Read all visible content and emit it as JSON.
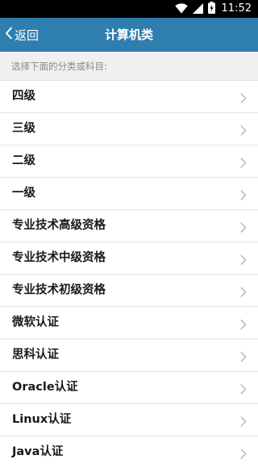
{
  "status_bar": {
    "time": "11:52",
    "icons": [
      "wifi-icon",
      "cellular-signal-icon",
      "battery-charging-icon"
    ]
  },
  "nav": {
    "back_label": "返回",
    "title": "计算机类",
    "background_color": "#2f7eb0"
  },
  "hint": "选择下面的分类或科目:",
  "list": {
    "items": [
      {
        "label": "四级"
      },
      {
        "label": "三级"
      },
      {
        "label": "二级"
      },
      {
        "label": "一级"
      },
      {
        "label": "专业技术高级资格"
      },
      {
        "label": "专业技术中级资格"
      },
      {
        "label": "专业技术初级资格"
      },
      {
        "label": "微软认证"
      },
      {
        "label": "思科认证"
      },
      {
        "label": "Oracle认证"
      },
      {
        "label": "Linux认证"
      },
      {
        "label": "Java认证"
      }
    ],
    "chevron_icon": "chevron-right-icon"
  }
}
